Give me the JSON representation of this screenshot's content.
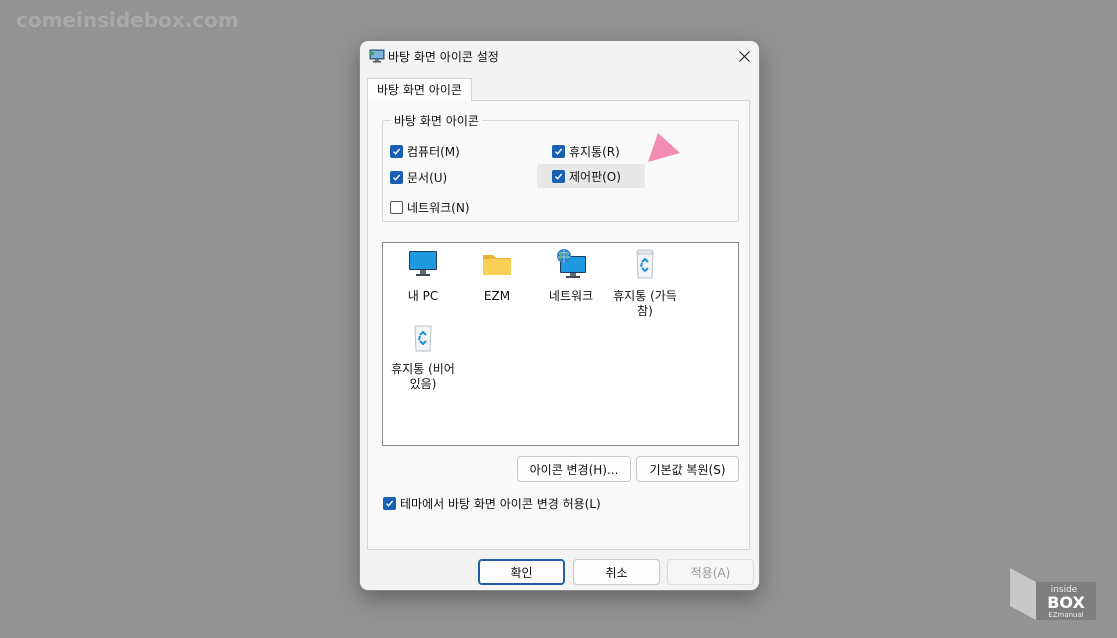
{
  "watermark": "comeinsidebox.com",
  "dialog": {
    "title": "바탕 화면 아이콘 설정",
    "tab_label": "바탕 화면 아이콘",
    "group_label": "바탕 화면 아이콘",
    "checkboxes": [
      {
        "label": "컴퓨터(M)",
        "checked": true
      },
      {
        "label": "휴지통(R)",
        "checked": true
      },
      {
        "label": "문서(U)",
        "checked": true
      },
      {
        "label": "제어판(O)",
        "checked": true
      },
      {
        "label": "네트워크(N)",
        "checked": false
      }
    ],
    "icons": [
      {
        "label": "내 PC",
        "icon": "monitor-icon"
      },
      {
        "label": "EZM",
        "icon": "folder-icon"
      },
      {
        "label": "네트워크",
        "icon": "network-icon"
      },
      {
        "label": "휴지통 (가득 참)",
        "icon": "recycle-bin-full-icon"
      },
      {
        "label": "휴지통 (비어 있음)",
        "icon": "recycle-bin-empty-icon"
      }
    ],
    "change_icon_button": "아이콘 변경(H)...",
    "restore_default_button": "기본값 복원(S)",
    "allow_themes": {
      "label": "테마에서 바탕 화면 아이콘 변경 허용(L)",
      "checked": true
    },
    "ok_button": "확인",
    "cancel_button": "취소",
    "apply_button": "적용(A)"
  },
  "logo": {
    "line1": "inside",
    "line2": "BOX",
    "line3": "EZmanual"
  },
  "colors": {
    "accent": "#1a60b0",
    "pointer_arrow": "#f48bb3"
  }
}
